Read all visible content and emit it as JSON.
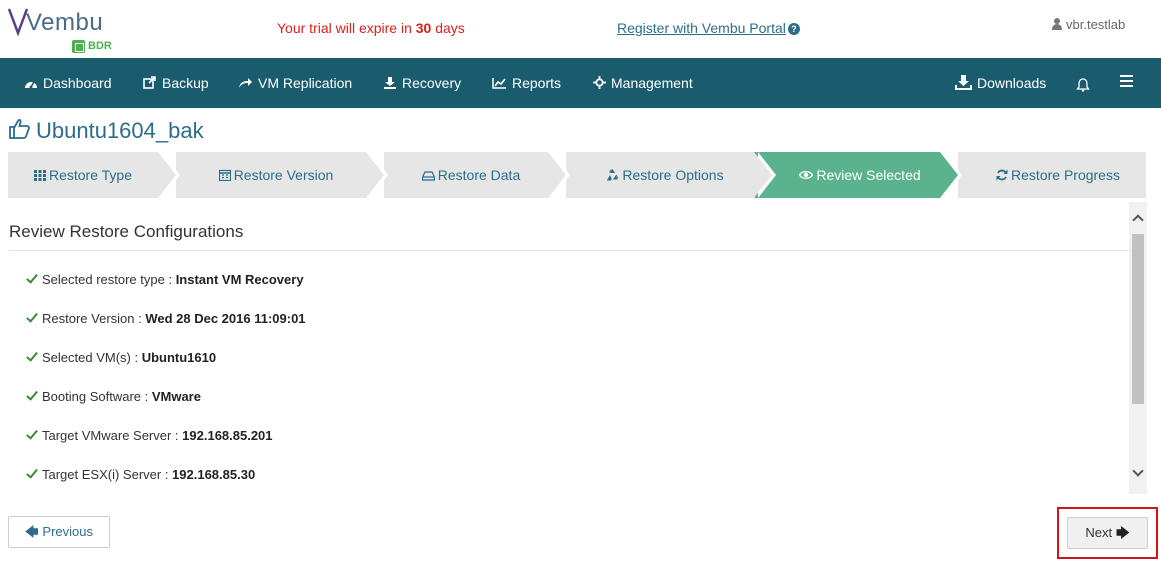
{
  "header": {
    "logo_text": "Vembu",
    "logo_sub": "BDR",
    "trial_prefix": "Your trial will expire in ",
    "trial_days": "30",
    "trial_suffix": " days",
    "register_link": "Register with Vembu Portal",
    "user": "vbr.testlab"
  },
  "nav": {
    "items": [
      {
        "label": "Dashboard",
        "icon": "dashboard-icon"
      },
      {
        "label": "Backup",
        "icon": "backup-icon"
      },
      {
        "label": "VM Replication",
        "icon": "replication-icon"
      },
      {
        "label": "Recovery",
        "icon": "recovery-icon"
      },
      {
        "label": "Reports",
        "icon": "reports-icon"
      },
      {
        "label": "Management",
        "icon": "management-icon"
      }
    ],
    "downloads": "Downloads",
    "colors": {
      "bar": "#1a5c6e"
    }
  },
  "page": {
    "title": "Ubuntu1604_bak"
  },
  "wizard": {
    "steps": [
      {
        "label": "Restore Type",
        "icon": "grid-icon"
      },
      {
        "label": "Restore Version",
        "icon": "calendar-icon"
      },
      {
        "label": "Restore Data",
        "icon": "drive-icon"
      },
      {
        "label": "Restore Options",
        "icon": "recycle-icon"
      },
      {
        "label": "Review Selected",
        "icon": "eye-icon",
        "active": true
      },
      {
        "label": "Restore Progress",
        "icon": "refresh-icon"
      }
    ],
    "active_color": "#5ab28e"
  },
  "review": {
    "heading": "Review Restore Configurations",
    "items": [
      {
        "label": "Selected restore type : ",
        "value": "Instant VM Recovery"
      },
      {
        "label": "Restore Version : ",
        "value": "Wed 28 Dec 2016 11:09:01"
      },
      {
        "label": "Selected VM(s) : ",
        "value": "Ubuntu1610"
      },
      {
        "label": "Booting Software : ",
        "value": "VMware"
      },
      {
        "label": "Target VMware Server : ",
        "value": "192.168.85.201"
      },
      {
        "label": "Target ESX(i) Server : ",
        "value": "192.168.85.30"
      }
    ]
  },
  "buttons": {
    "previous": "Previous",
    "next": "Next"
  }
}
